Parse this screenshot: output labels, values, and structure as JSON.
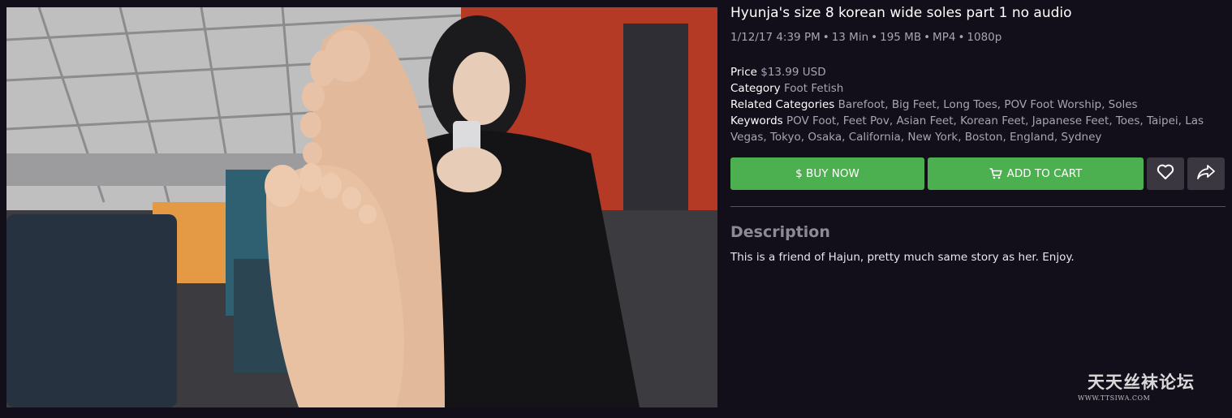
{
  "product": {
    "title": "Hyunja's size 8 korean wide soles part 1 no audio",
    "meta": {
      "date": "1/12/17 4:39 PM",
      "duration": "13 Min",
      "size": "195 MB",
      "format": "MP4",
      "resolution": "1080p",
      "separator": "•"
    }
  },
  "details": {
    "price_label": "Price",
    "price_value": "$13.99 USD",
    "category_label": "Category",
    "category_value": "Foot Fetish",
    "related_label": "Related Categories",
    "related_value": "Barefoot, Big Feet, Long Toes, POV Foot Worship, Soles",
    "keywords_label": "Keywords",
    "keywords_value": "POV Foot, Feet Pov, Asian Feet, Korean Feet, Japanese Feet, Toes, Taipei, Las Vegas, Tokyo, Osaka, California, New York, Boston, England, Sydney"
  },
  "actions": {
    "buy_label": "$ BUY NOW",
    "cart_label": "ADD TO CART",
    "cart_icon": "cart-icon",
    "favorite_icon": "heart-icon",
    "share_icon": "share-icon"
  },
  "description": {
    "heading": "Description",
    "text": "This is a friend of Hajun, pretty much same story as her. Enjoy."
  },
  "watermark": {
    "name": "天天丝袜论坛",
    "url": "WWW.TTSIWA.COM"
  },
  "colors": {
    "background": "#120f1a",
    "accent_green": "#4caf50",
    "icon_button": "#3a3740",
    "muted_text": "#a8a4b2"
  }
}
